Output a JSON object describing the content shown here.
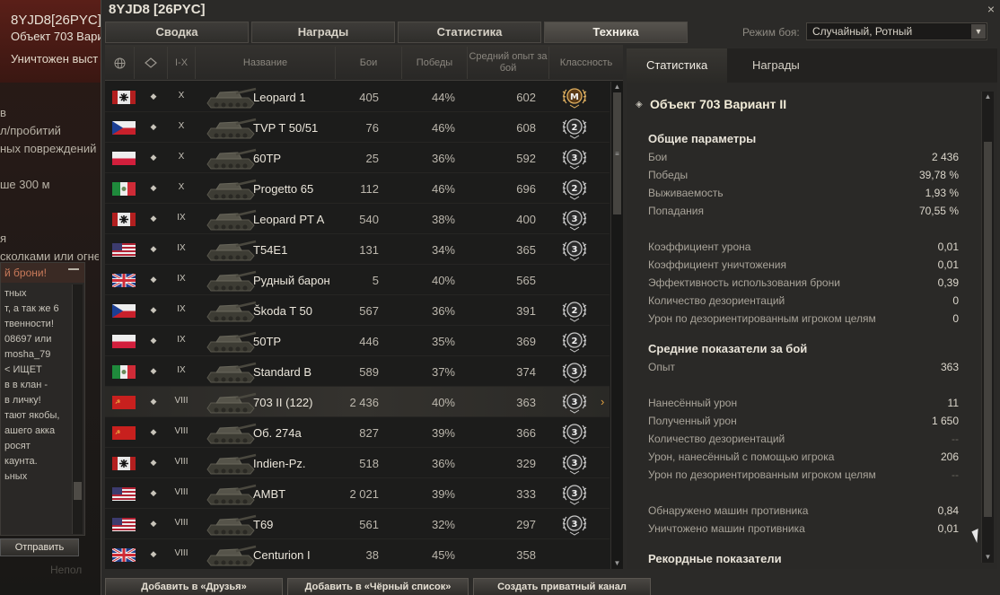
{
  "background": {
    "player_name": "8YJD8[26PYC]",
    "vehicle_line": "Объект 703 Вари",
    "kill_line": "Уничтожен выст",
    "lines": [
      "в",
      "л/пробитий",
      "ных повреждений",
      "",
      "ше 300 м",
      "",
      "",
      "я",
      "сколками или огне"
    ],
    "chat": {
      "title": "й брони!",
      "text_lines": [
        "тных",
        "т, а так же 6",
        "твенности!",
        "08697 или",
        "mosha_79",
        "< ИЩЕТ",
        "в в клан -",
        "в личку!",
        "",
        "тают якобы,",
        "ашего акка",
        "росят",
        "каунта.",
        "ьных"
      ],
      "send_label": "Отправить"
    },
    "bottom_text": "Непол"
  },
  "window": {
    "title": "8YJD8 [26PYC]",
    "close_glyph": "×"
  },
  "tabs": [
    "Сводка",
    "Награды",
    "Статистика",
    "Техника"
  ],
  "active_tab": 3,
  "battle_mode": {
    "label": "Режим боя:",
    "value": "Случайный, Ротный"
  },
  "table": {
    "headers": {
      "nation": "🌐",
      "type": "◇",
      "tier": "I-X",
      "name": "Название",
      "battles": "Бои",
      "wins": "Победы",
      "avg_xp": "Средний опыт за бой",
      "mastery": "Классность"
    },
    "rows": [
      {
        "flag": "germany",
        "tier": "X",
        "name": "Leopard 1",
        "battles": "405",
        "wins": "44%",
        "xp": "602",
        "mastery": "M"
      },
      {
        "flag": "czech",
        "tier": "X",
        "name": "TVP T 50/51",
        "battles": "76",
        "wins": "46%",
        "xp": "608",
        "mastery": "2"
      },
      {
        "flag": "poland",
        "tier": "X",
        "name": "60TP",
        "battles": "25",
        "wins": "36%",
        "xp": "592",
        "mastery": "3"
      },
      {
        "flag": "italy",
        "tier": "X",
        "name": "Progetto 65",
        "battles": "112",
        "wins": "46%",
        "xp": "696",
        "mastery": "2"
      },
      {
        "flag": "germany",
        "tier": "IX",
        "name": "Leopard PT A",
        "battles": "540",
        "wins": "38%",
        "xp": "400",
        "mastery": "3"
      },
      {
        "flag": "usa",
        "tier": "IX",
        "name": "T54E1",
        "battles": "131",
        "wins": "34%",
        "xp": "365",
        "mastery": "3"
      },
      {
        "flag": "uk",
        "tier": "IX",
        "name": "Рудный барон",
        "battles": "5",
        "wins": "40%",
        "xp": "565",
        "mastery": ""
      },
      {
        "flag": "czech",
        "tier": "IX",
        "name": "Škoda T 50",
        "battles": "567",
        "wins": "36%",
        "xp": "391",
        "mastery": "2"
      },
      {
        "flag": "poland",
        "tier": "IX",
        "name": "50TP",
        "battles": "446",
        "wins": "35%",
        "xp": "369",
        "mastery": "2"
      },
      {
        "flag": "italy",
        "tier": "IX",
        "name": "Standard B",
        "battles": "589",
        "wins": "37%",
        "xp": "374",
        "mastery": "3"
      },
      {
        "flag": "ussr",
        "tier": "VIII",
        "name": "703 II (122)",
        "battles": "2 436",
        "wins": "40%",
        "xp": "363",
        "mastery": "3",
        "selected": true
      },
      {
        "flag": "ussr",
        "tier": "VIII",
        "name": "Об. 274а",
        "battles": "827",
        "wins": "39%",
        "xp": "366",
        "mastery": "3"
      },
      {
        "flag": "germany",
        "tier": "VIII",
        "name": "Indien-Pz.",
        "battles": "518",
        "wins": "36%",
        "xp": "329",
        "mastery": "3"
      },
      {
        "flag": "usa",
        "tier": "VIII",
        "name": "AMBT",
        "battles": "2 021",
        "wins": "39%",
        "xp": "333",
        "mastery": "3"
      },
      {
        "flag": "usa",
        "tier": "VIII",
        "name": "T69",
        "battles": "561",
        "wins": "32%",
        "xp": "297",
        "mastery": "3"
      },
      {
        "flag": "uk",
        "tier": "VIII",
        "name": "Centurion I",
        "battles": "38",
        "wins": "45%",
        "xp": "358",
        "mastery": ""
      }
    ],
    "selected_arrow": "›"
  },
  "right_panel": {
    "tabs": [
      "Статистика",
      "Награды"
    ],
    "vehicle_title": "Объект 703 Вариант II",
    "sections": {
      "general": {
        "title": "Общие параметры",
        "items": [
          {
            "k": "Бои",
            "v": "2 436"
          },
          {
            "k": "Победы",
            "v": "39,78 %"
          },
          {
            "k": "Выживаемость",
            "v": "1,93 %"
          },
          {
            "k": "Попадания",
            "v": "70,55 %"
          },
          {
            "k": "",
            "v": ""
          },
          {
            "k": "Коэффициент урона",
            "v": "0,01"
          },
          {
            "k": "Коэффициент уничтожения",
            "v": "0,01"
          },
          {
            "k": "Эффективность использования брони",
            "v": "0,39"
          },
          {
            "k": "Количество дезориентаций",
            "v": "0"
          },
          {
            "k": "Урон по дезориентированным игроком целям",
            "v": "0"
          }
        ]
      },
      "average": {
        "title": "Средние показатели за бой",
        "items": [
          {
            "k": "Опыт",
            "v": "363"
          },
          {
            "k": "",
            "v": ""
          },
          {
            "k": "Нанесённый урон",
            "v": "11"
          },
          {
            "k": "Полученный урон",
            "v": "1 650"
          },
          {
            "k": "Количество дезориентаций",
            "v": "--",
            "dim": true
          },
          {
            "k": "Урон, нанесённый с помощью игрока",
            "v": "206"
          },
          {
            "k": "Урон по дезориентированным игроком целям",
            "v": "--",
            "dim": true
          },
          {
            "k": "",
            "v": ""
          },
          {
            "k": "Обнаружено машин противника",
            "v": "0,84"
          },
          {
            "k": "Уничтожено машин противника",
            "v": "0,01"
          }
        ]
      },
      "records": {
        "title": "Рекордные показатели"
      }
    }
  },
  "buttons": {
    "add_friend": "Добавить в «Друзья»",
    "add_blacklist": "Добавить в «Чёрный список»",
    "private_channel": "Создать приватный канал"
  },
  "colors": {
    "accent_arrow": "#e0a040",
    "panel_bg": "#2a2927",
    "table_bg": "#1c1c1b"
  }
}
